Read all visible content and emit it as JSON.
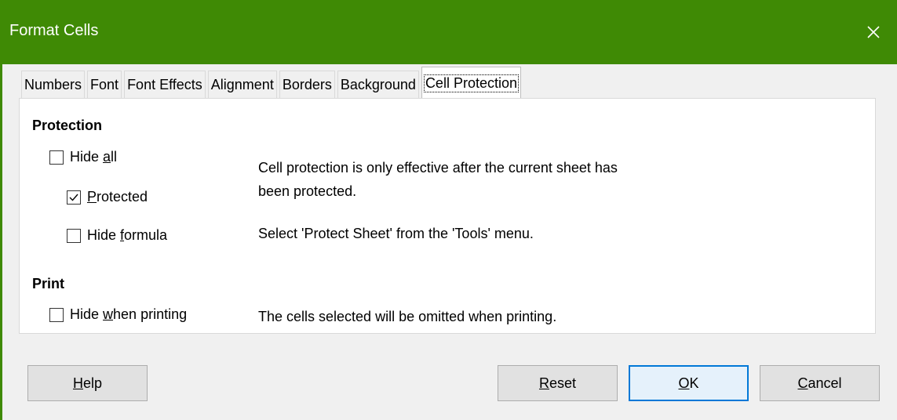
{
  "window": {
    "title": "Format Cells"
  },
  "tabs": [
    {
      "label": "Numbers"
    },
    {
      "label": "Font"
    },
    {
      "label": "Font Effects"
    },
    {
      "label": "Alignment"
    },
    {
      "label": "Borders"
    },
    {
      "label": "Background"
    },
    {
      "label": "Cell Protection",
      "active": true
    }
  ],
  "protection": {
    "title": "Protection",
    "hide_all": {
      "pre": "Hide ",
      "u": "a",
      "post": "ll",
      "checked": false
    },
    "protected": {
      "pre": "",
      "u": "P",
      "post": "rotected",
      "checked": true
    },
    "hide_formula": {
      "pre": "Hide ",
      "u": "f",
      "post": "ormula",
      "checked": false
    },
    "info1_line1": "Cell protection is only effective after the current sheet has",
    "info1_line2": "been protected.",
    "info2": "Select 'Protect Sheet' from the 'Tools' menu."
  },
  "print": {
    "title": "Print",
    "hide_when_printing": {
      "pre": "Hide ",
      "u": "w",
      "post": "hen printing",
      "checked": false
    },
    "info": "The cells selected will be omitted when printing."
  },
  "buttons": {
    "help": {
      "u": "H",
      "post": "elp"
    },
    "reset": {
      "u": "R",
      "post": "eset"
    },
    "ok": {
      "u": "O",
      "post": "K"
    },
    "cancel": {
      "u": "C",
      "post": "ancel"
    }
  }
}
